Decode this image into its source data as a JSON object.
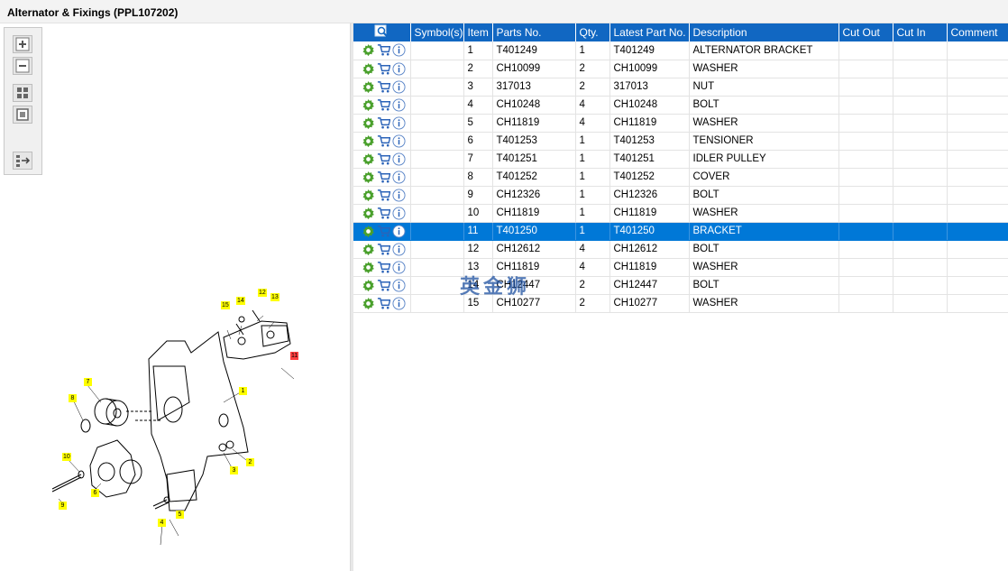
{
  "title": "Alternator & Fixings (PPL107202)",
  "columns": [
    "Symbol(s)",
    "Item",
    "Parts No.",
    "Qty.",
    "Latest Part No.",
    "Description",
    "Cut Out",
    "Cut In",
    "Comment"
  ],
  "rows": [
    {
      "item": "1",
      "part": "T401249",
      "qty": "1",
      "latest": "T401249",
      "desc": "ALTERNATOR BRACKET"
    },
    {
      "item": "2",
      "part": "CH10099",
      "qty": "2",
      "latest": "CH10099",
      "desc": "WASHER"
    },
    {
      "item": "3",
      "part": "317013",
      "qty": "2",
      "latest": "317013",
      "desc": "NUT"
    },
    {
      "item": "4",
      "part": "CH10248",
      "qty": "4",
      "latest": "CH10248",
      "desc": "BOLT"
    },
    {
      "item": "5",
      "part": "CH11819",
      "qty": "4",
      "latest": "CH11819",
      "desc": "WASHER"
    },
    {
      "item": "6",
      "part": "T401253",
      "qty": "1",
      "latest": "T401253",
      "desc": "TENSIONER"
    },
    {
      "item": "7",
      "part": "T401251",
      "qty": "1",
      "latest": "T401251",
      "desc": "IDLER PULLEY"
    },
    {
      "item": "8",
      "part": "T401252",
      "qty": "1",
      "latest": "T401252",
      "desc": "COVER"
    },
    {
      "item": "9",
      "part": "CH12326",
      "qty": "1",
      "latest": "CH12326",
      "desc": "BOLT"
    },
    {
      "item": "10",
      "part": "CH11819",
      "qty": "1",
      "latest": "CH11819",
      "desc": "WASHER"
    },
    {
      "item": "11",
      "part": "T401250",
      "qty": "1",
      "latest": "T401250",
      "desc": "BRACKET",
      "selected": true
    },
    {
      "item": "12",
      "part": "CH12612",
      "qty": "4",
      "latest": "CH12612",
      "desc": "BOLT"
    },
    {
      "item": "13",
      "part": "CH11819",
      "qty": "4",
      "latest": "CH11819",
      "desc": "WASHER"
    },
    {
      "item": "14",
      "part": "CH12447",
      "qty": "2",
      "latest": "CH12447",
      "desc": "BOLT"
    },
    {
      "item": "15",
      "part": "CH10277",
      "qty": "2",
      "latest": "CH10277",
      "desc": "WASHER"
    }
  ],
  "row_icons": [
    "gear-icon",
    "cart-icon",
    "info-icon"
  ],
  "toolbar_icons": [
    "zoom-in-icon",
    "zoom-out-icon",
    "fit-all-icon",
    "actual-size-icon",
    "list-arrow-icon"
  ],
  "watermark": "英金狮",
  "callouts": [
    "1",
    "2",
    "3",
    "4",
    "5",
    "6",
    "7",
    "8",
    "9",
    "10",
    "11",
    "12",
    "13",
    "14",
    "15"
  ],
  "colors": {
    "header": "#1167c2",
    "selected_row": "#0078d7",
    "callout": "#ffff00",
    "callout_selected": "#ff4040"
  }
}
